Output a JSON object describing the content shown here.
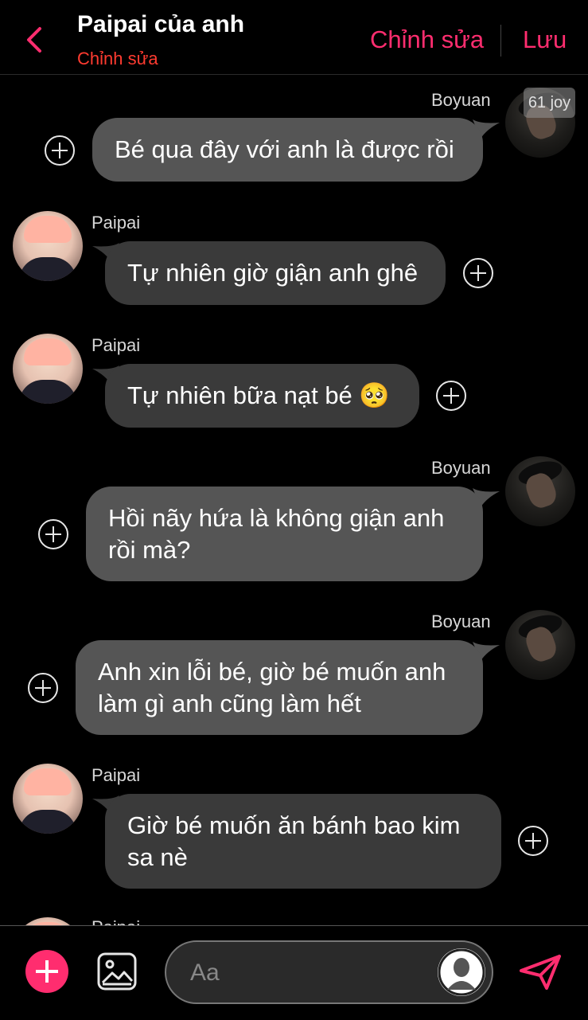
{
  "header": {
    "title": "Paipai của anh",
    "subtitle": "Chỉnh sửa",
    "edit_label": "Chỉnh sửa",
    "save_label": "Lưu"
  },
  "watermark": "61 joy",
  "messages": [
    {
      "sender": "Boyuan",
      "text_lines": [
        "Bé qua đây với anh là được rồi"
      ],
      "side": "right"
    },
    {
      "sender": "Paipai",
      "text_lines": [
        "Tự nhiên giờ giận anh ghê"
      ],
      "side": "left"
    },
    {
      "sender": "Paipai",
      "text_lines": [
        "Tự nhiên bữa nạt bé 🥺"
      ],
      "side": "left"
    },
    {
      "sender": "Boyuan",
      "text_lines": [
        "Hồi nãy hứa là không giận anh",
        "rồi mà?"
      ],
      "side": "right"
    },
    {
      "sender": "Boyuan",
      "text_lines": [
        "Anh xin lỗi bé, giờ bé muốn anh",
        "làm gì anh cũng làm hết"
      ],
      "side": "right"
    },
    {
      "sender": "Paipai",
      "text_lines": [
        "Giờ bé muốn ăn bánh bao kim",
        "sa nè"
      ],
      "side": "left"
    },
    {
      "sender": "Paipai",
      "text_lines": [],
      "side": "left"
    }
  ],
  "composer": {
    "placeholder": "Aa"
  },
  "colors": {
    "accent": "#ff2d6f",
    "subtitle": "#ff3b30",
    "outgoing_bubble": "#555555",
    "incoming_bubble": "#3a3a3a"
  },
  "icons": [
    "back-chevron-icon",
    "plus-circle-icon",
    "image-icon",
    "send-icon",
    "user-silhouette-icon"
  ]
}
